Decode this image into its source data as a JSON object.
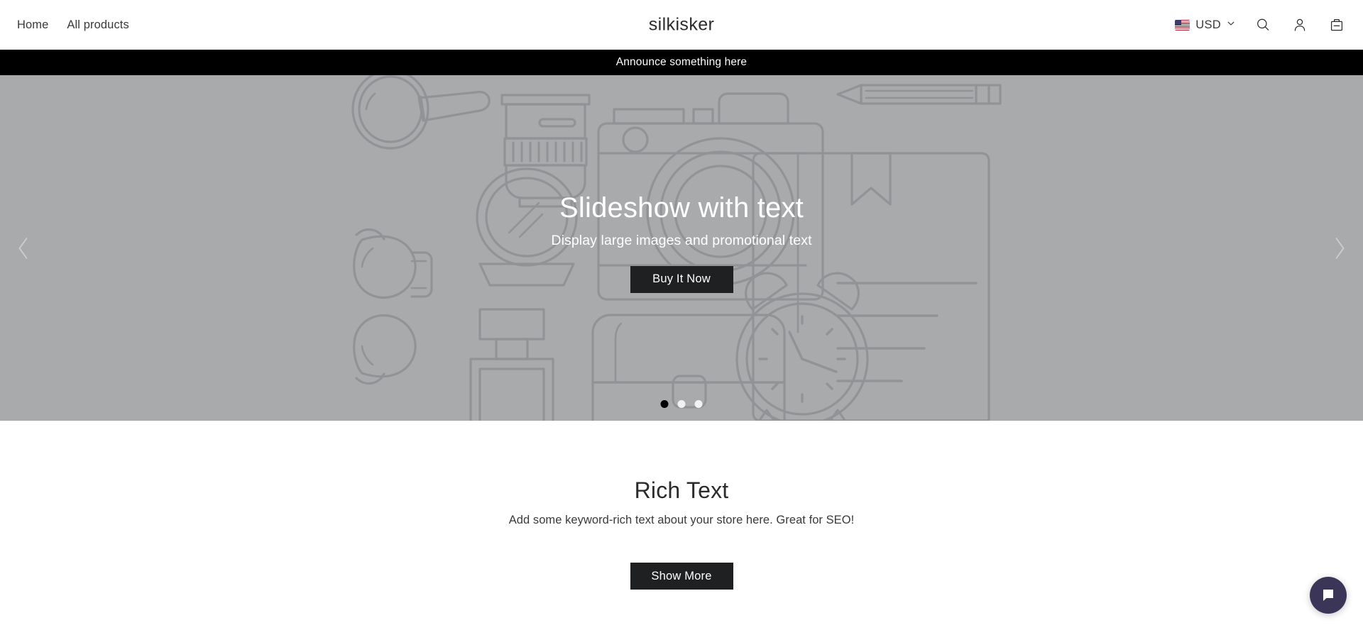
{
  "header": {
    "logo": "silkisker",
    "nav_links": [
      {
        "label": "Home"
      },
      {
        "label": "All products"
      }
    ],
    "currency": {
      "label": "USD",
      "flag": "us-flag-icon",
      "chevron": "chevron-down-icon"
    },
    "icons": [
      {
        "name": "search-icon"
      },
      {
        "name": "account-icon"
      },
      {
        "name": "cart-icon"
      }
    ]
  },
  "announcement": {
    "text": "Announce something here",
    "background": "#000000",
    "color": "#ffffff"
  },
  "slideshow": {
    "title": "Slideshow with text",
    "subtitle": "Display large images and promotional text",
    "button_label": "Buy It Now",
    "background_color": "#a9aaac",
    "button_color": "#1f2021",
    "prev_arrow": "chevron-left-icon",
    "next_arrow": "chevron-right-icon",
    "dots": [
      {
        "active": true
      },
      {
        "active": false
      },
      {
        "active": false
      }
    ],
    "placeholder_objects": [
      "magnifying-glass",
      "camera-lens",
      "camera",
      "pencil",
      "hand-mirror",
      "book-with-bookmark",
      "sunglasses",
      "perfume-bottle",
      "briefcase",
      "alarm-clock"
    ]
  },
  "rich_text": {
    "title": "Rich Text",
    "body": "Add some keyword-rich text about your store here. Great for SEO!",
    "button_label": "Show More"
  },
  "chat": {
    "icon": "chat-bubble-icon",
    "color": "#3b3558"
  }
}
